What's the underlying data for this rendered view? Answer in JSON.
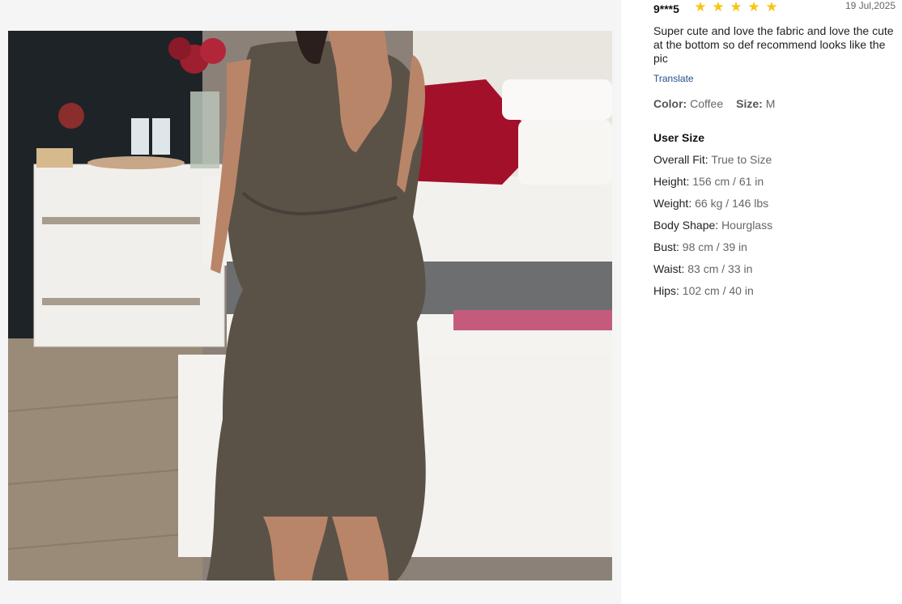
{
  "gallery": {
    "photo_alt": "Customer photo"
  },
  "review": {
    "user": "9***5",
    "rating": 5,
    "stars": [
      "★",
      "★",
      "★",
      "★",
      "★"
    ],
    "date": "19 Jul,2025",
    "text": "Super cute and love the fabric and love the cute at the bottom so def recommend looks like the pic",
    "translate_label": "Translate",
    "color_label": "Color:",
    "color_value": "Coffee",
    "size_label": "Size:",
    "size_value": "M"
  },
  "user_size": {
    "title": "User Size",
    "rows": [
      {
        "label": "Overall Fit:",
        "value": "True to Size"
      },
      {
        "label": "Height:",
        "value": "156 cm / 61 in"
      },
      {
        "label": "Weight:",
        "value": "66 kg / 146 lbs"
      },
      {
        "label": "Body Shape:",
        "value": "Hourglass"
      },
      {
        "label": "Bust:",
        "value": "98 cm / 39 in"
      },
      {
        "label": "Waist:",
        "value": "83 cm / 33 in"
      },
      {
        "label": "Hips:",
        "value": "102 cm / 40 in"
      }
    ]
  },
  "colors": {
    "star": "#f5c518",
    "link": "#1f4f8f",
    "dress": "#5a5247"
  }
}
